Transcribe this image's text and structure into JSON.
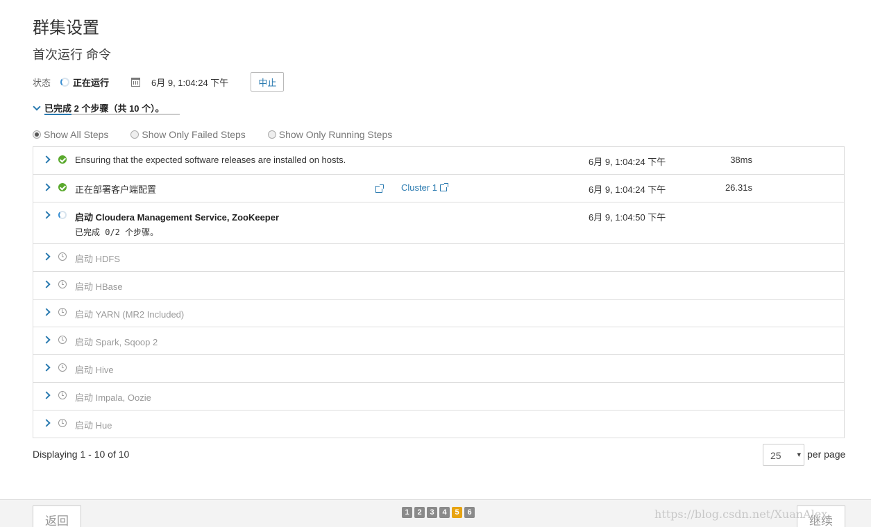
{
  "page": {
    "title": "群集设置",
    "subtitle": "首次运行 命令"
  },
  "status": {
    "label": "状态",
    "value": "正在运行",
    "date": "6月 9, 1:04:24 下午",
    "abort_label": "中止"
  },
  "progress": {
    "text": "已完成 2 个步骤（共 10 个）。",
    "completed": 2,
    "total": 10
  },
  "filters": [
    {
      "label": "Show All Steps",
      "selected": true
    },
    {
      "label": "Show Only Failed Steps",
      "selected": false
    },
    {
      "label": "Show Only Running Steps",
      "selected": false
    }
  ],
  "steps": [
    {
      "name": "Ensuring that the expected software releases are installed on hosts.",
      "status": "success",
      "time": "6月 9, 1:04:24 下午",
      "duration": "38ms"
    },
    {
      "name": "正在部署客户端配置",
      "status": "success",
      "time": "6月 9, 1:04:24 下午",
      "duration": "26.31s",
      "cluster_link": "Cluster 1"
    },
    {
      "name": "启动 Cloudera Management Service, ZooKeeper",
      "status": "running",
      "time": "6月 9, 1:04:50 下午",
      "duration": "",
      "sub": "已完成 0/2 个步骤。"
    },
    {
      "name": "启动 HDFS",
      "status": "pending"
    },
    {
      "name": "启动 HBase",
      "status": "pending"
    },
    {
      "name": "启动 YARN (MR2 Included)",
      "status": "pending"
    },
    {
      "name": "启动 Spark, Sqoop 2",
      "status": "pending"
    },
    {
      "name": "启动 Hive",
      "status": "pending"
    },
    {
      "name": "启动 Impala, Oozie",
      "status": "pending"
    },
    {
      "name": "启动 Hue",
      "status": "pending"
    }
  ],
  "pagination": {
    "display_text": "Displaying 1 - 10 of 10",
    "per_page_value": "25",
    "per_page_label": "per page"
  },
  "footer": {
    "back_label": "返回",
    "continue_label": "继续",
    "wizard_steps": [
      "1",
      "2",
      "3",
      "4",
      "5",
      "6"
    ],
    "active_step": "5",
    "watermark": "https://blog.csdn.net/XuanAlex"
  },
  "colors": {
    "accent": "#2a7ab0",
    "success": "#5aa92d",
    "active_step": "#e8a411"
  },
  "icons": {
    "status": "spinner-icon",
    "date": "calendar-icon",
    "expand": "chevron-right-icon",
    "success": "check-circle-icon",
    "pending": "clock-icon",
    "external": "external-link-icon"
  }
}
